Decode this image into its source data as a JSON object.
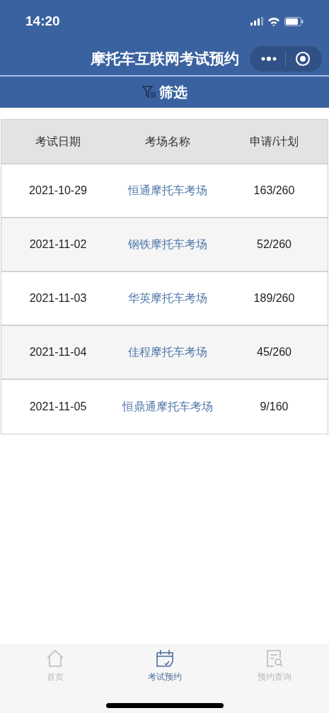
{
  "status_bar": {
    "time": "14:20"
  },
  "nav_bar": {
    "title": "摩托车互联网考试预约"
  },
  "filter": {
    "label": "筛选"
  },
  "table": {
    "columns": [
      "考试日期",
      "考场名称",
      "申请/计划"
    ],
    "rows": [
      {
        "date": "2021-10-29",
        "venue": "恒通摩托车考场",
        "quota": "163/260"
      },
      {
        "date": "2021-11-02",
        "venue": "钢铁摩托车考场",
        "quota": "52/260"
      },
      {
        "date": "2021-11-03",
        "venue": "华英摩托车考场",
        "quota": "189/260"
      },
      {
        "date": "2021-11-04",
        "venue": "佳程摩托车考场",
        "quota": "45/260"
      },
      {
        "date": "2021-11-05",
        "venue": "恒鼎通摩托车考场",
        "quota": "9/160"
      }
    ]
  },
  "tab_bar": [
    {
      "kind": "home",
      "label": "首页",
      "selected": false
    },
    {
      "kind": "calendar",
      "label": "考试预约",
      "selected": true
    },
    {
      "kind": "search",
      "label": "预约查询",
      "selected": false
    }
  ]
}
